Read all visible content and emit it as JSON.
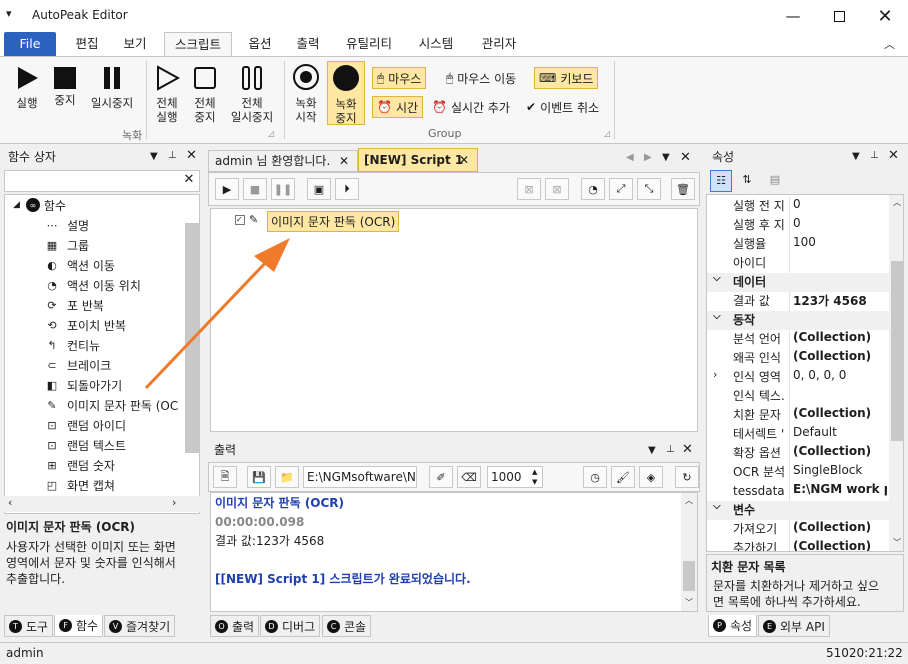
{
  "app": {
    "title": "AutoPeak Editor"
  },
  "ribbon_tabs": [
    "File",
    "편집",
    "보기",
    "스크립트",
    "옵션",
    "출력",
    "유틸리티",
    "시스템",
    "관리자"
  ],
  "ribbon": {
    "run": "실행",
    "stop": "중지",
    "pause": "일시중지",
    "all_run": [
      "전체",
      "실행"
    ],
    "all_stop": [
      "전체",
      "중지"
    ],
    "all_pause": [
      "전체",
      "일시중지"
    ],
    "rec_start": [
      "녹화",
      "시작"
    ],
    "rec_stop": [
      "녹화",
      "중지"
    ],
    "group_record": "녹화",
    "group_group": "Group",
    "mouse": "마우스",
    "mouse_move": "마우스 이동",
    "keyboard": "키보드",
    "time": "시간",
    "realtime_add": "실시간 추가",
    "event_cancel": "이벤트 취소"
  },
  "func_box": {
    "title": "함수 상자",
    "root": "함수",
    "items": [
      "설명",
      "그룹",
      "액션 이동",
      "액션 이동 위치",
      "포 반복",
      "포이치 반복",
      "컨티뉴",
      "브레이크",
      "되돌아가기",
      "이미지 문자 판독 (OC",
      "랜덤 아이디",
      "랜덤 텍스트",
      "랜덤 숫자",
      "화면 캡쳐"
    ],
    "desc_title": "이미지 문자 판독 (OCR)",
    "desc_text": [
      "사용자가 선택한 이미지 또는 화면",
      "영역에서 문자 및 숫자를 인식해서",
      "추출합니다."
    ],
    "tabs": [
      {
        "key": "T",
        "label": "도구"
      },
      {
        "key": "F",
        "label": "함수"
      },
      {
        "key": "V",
        "label": "즐겨찾기"
      }
    ]
  },
  "doc_tabs": [
    "admin 님 환영합니다.",
    "[NEW] Script 1"
  ],
  "script": {
    "node": "이미지 문자 판독 (OCR)"
  },
  "output": {
    "title": "출력",
    "path": "E:\\NGMsoftware\\NG",
    "interval": "1000",
    "lines": [
      {
        "text": "이미지 문자 판독 (OCR)",
        "color": "#1f3fb0",
        "bold": true
      },
      {
        "text": "00:00:00.098",
        "color": "#888888",
        "bold": true
      },
      {
        "text": "결과 값:123가 4568",
        "color": "#1e1e1e",
        "bold": false
      },
      {
        "text": "",
        "color": "#1e1e1e",
        "bold": false
      },
      {
        "text": "[[NEW] Script 1] 스크립트가 완료되었습니다.",
        "color": "#1f3fb0",
        "bold": true
      }
    ],
    "tabs": [
      {
        "key": "O",
        "label": "출력"
      },
      {
        "key": "D",
        "label": "디버그"
      },
      {
        "key": "C",
        "label": "콘솔"
      }
    ]
  },
  "props": {
    "title": "속성",
    "rows": [
      {
        "t": "p",
        "k": "실행 전 지",
        "v": "0"
      },
      {
        "t": "p",
        "k": "실행 후 지",
        "v": "0"
      },
      {
        "t": "p",
        "k": "실행율",
        "v": "100"
      },
      {
        "t": "p",
        "k": "아이디",
        "v": ""
      },
      {
        "t": "c",
        "k": "데이터"
      },
      {
        "t": "p",
        "k": "결과 값",
        "v": "123가 4568",
        "b": true
      },
      {
        "t": "c",
        "k": "동작"
      },
      {
        "t": "p",
        "k": "분석 언어",
        "v": "(Collection)",
        "b": true
      },
      {
        "t": "p",
        "k": "왜곡 인식",
        "v": "(Collection)",
        "b": true
      },
      {
        "t": "p",
        "k": "인식 영역",
        "v": "0, 0, 0, 0",
        "exp": true
      },
      {
        "t": "p",
        "k": "인식 텍스.",
        "v": ""
      },
      {
        "t": "p",
        "k": "치환 문자",
        "v": "(Collection)",
        "b": true
      },
      {
        "t": "p",
        "k": "테서렉트 '",
        "v": "Default"
      },
      {
        "t": "p",
        "k": "확장 옵션",
        "v": "(Collection)",
        "b": true
      },
      {
        "t": "p",
        "k": "OCR 분석",
        "v": "SingleBlock"
      },
      {
        "t": "p",
        "k": "tessdata 폴",
        "v": "E:\\NGM work p",
        "b": true
      },
      {
        "t": "c",
        "k": "변수"
      },
      {
        "t": "p",
        "k": "가져오기",
        "v": "(Collection)",
        "b": true
      },
      {
        "t": "p",
        "k": "추가하기",
        "v": "(Collection)",
        "b": true
      }
    ],
    "desc_title": "치환 문자 목록",
    "desc_text": [
      "문자를 치환하거나 제거하고 싶으",
      "면 목록에 하나씩 추가하세요."
    ],
    "tabs": [
      {
        "key": "P",
        "label": "속성"
      },
      {
        "key": "E",
        "label": "외부 API"
      }
    ]
  },
  "status": {
    "user": "admin",
    "code": "51020:21:22"
  },
  "colors": {
    "file_tab": "#2b62c0",
    "selected": "#fde7a2",
    "accent_arrow": "#f07a2c"
  }
}
